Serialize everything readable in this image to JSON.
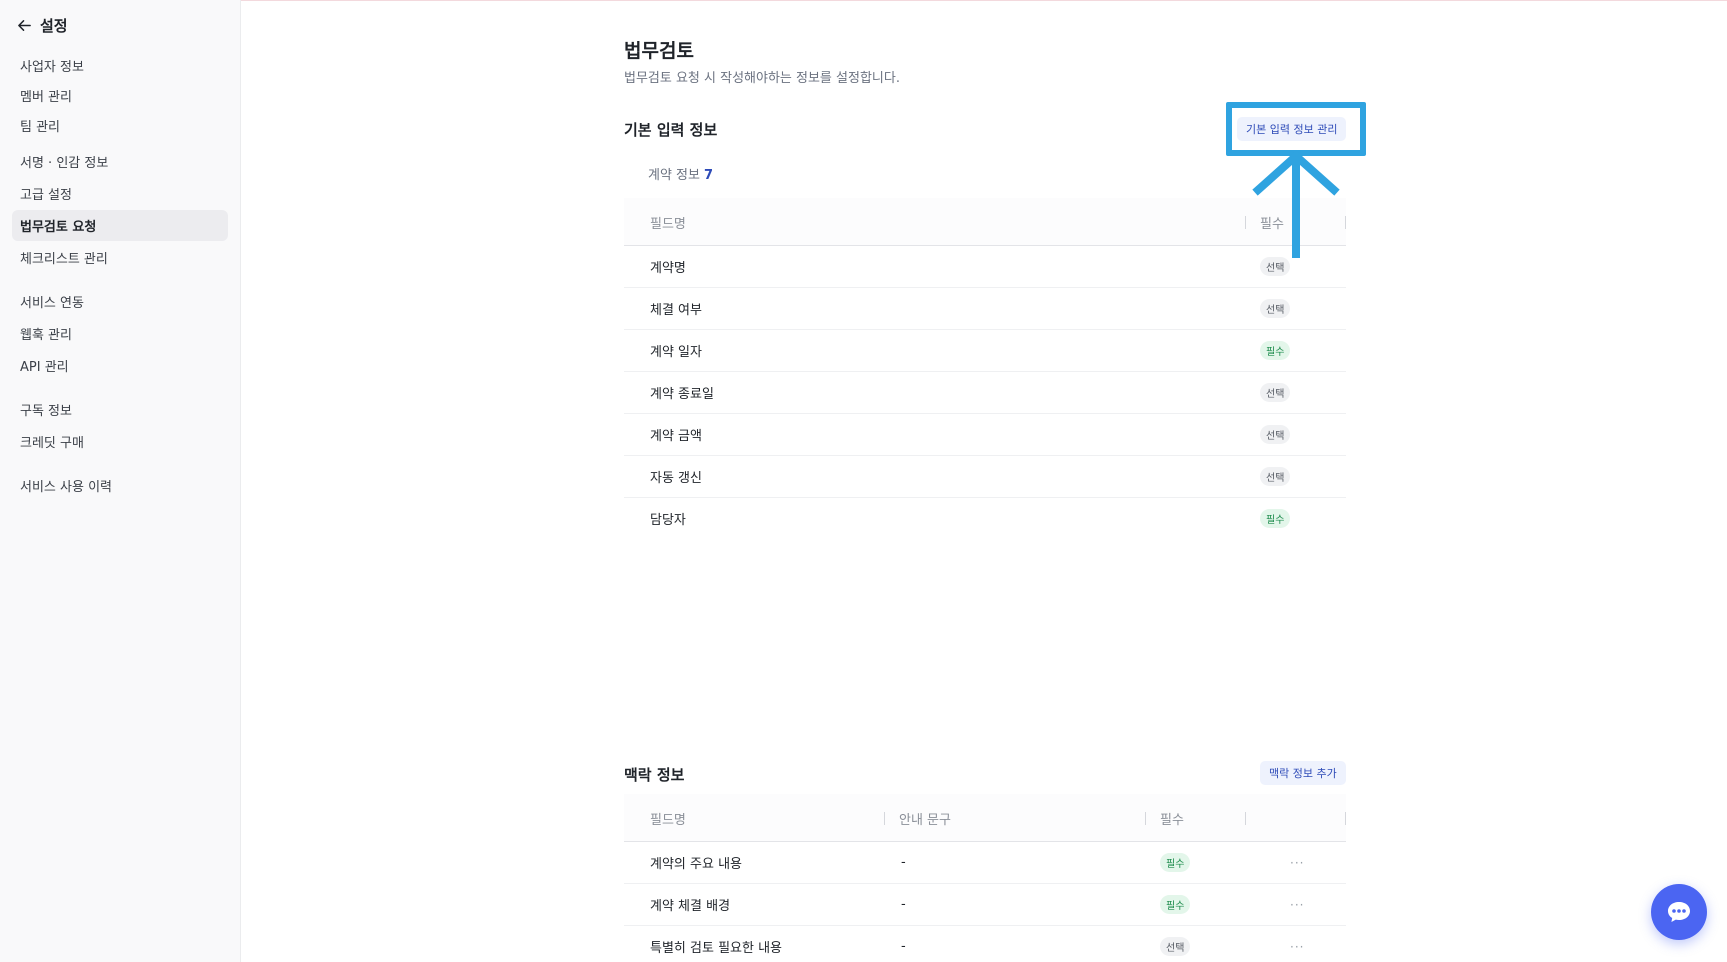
{
  "sidebar": {
    "title": "설정",
    "items": [
      {
        "label": "사업자 정보"
      },
      {
        "label": "멤버 관리"
      },
      {
        "label": "팀 관리"
      },
      {
        "label": "서명 · 인감 정보"
      },
      {
        "label": "고급 설정"
      },
      {
        "label": "법무검토 요청",
        "active": true
      },
      {
        "label": "체크리스트 관리"
      },
      {
        "label": "서비스 연동"
      },
      {
        "label": "웹훅 관리"
      },
      {
        "label": "API 관리"
      },
      {
        "label": "구독 정보"
      },
      {
        "label": "크레딧 구매"
      },
      {
        "label": "서비스 사용 이력"
      }
    ]
  },
  "page": {
    "title": "법무검토",
    "description": "법무검토 요청 시 작성해야하는 정보를 설정합니다."
  },
  "basic_info": {
    "title": "기본 입력 정보",
    "manage_button": "기본 입력 정보 관리",
    "tab_label": "계약 정보",
    "tab_count": "7",
    "columns": {
      "name": "필드명",
      "required": "필수"
    },
    "rows": [
      {
        "name": "계약명",
        "badge": "선택",
        "required": false
      },
      {
        "name": "체결 여부",
        "badge": "선택",
        "required": false
      },
      {
        "name": "계약 일자",
        "badge": "필수",
        "required": true
      },
      {
        "name": "계약 종료일",
        "badge": "선택",
        "required": false
      },
      {
        "name": "계약 금액",
        "badge": "선택",
        "required": false
      },
      {
        "name": "자동 갱신",
        "badge": "선택",
        "required": false
      },
      {
        "name": "담당자",
        "badge": "필수",
        "required": true
      }
    ]
  },
  "context_info": {
    "title": "맥락 정보",
    "add_button": "맥락 정보 추가",
    "columns": {
      "name": "필드명",
      "guide": "안내 문구",
      "required": "필수"
    },
    "rows": [
      {
        "name": "계약의 주요 내용",
        "guide": "-",
        "badge": "필수",
        "required": true,
        "more": "···"
      },
      {
        "name": "계약 체결 배경",
        "guide": "-",
        "badge": "필수",
        "required": true,
        "more": "···"
      },
      {
        "name": "특별히 검토 필요한 내용",
        "guide": "-",
        "badge": "선택",
        "required": false,
        "more": "···"
      }
    ]
  },
  "icons": {
    "back": "arrow-left-icon",
    "chat": "chat-bubble-icon"
  },
  "colors": {
    "accent": "#2e4bb8",
    "highlight": "#2fa3e0",
    "required_badge": "#1a8a4a",
    "chat_button": "#4b65f2"
  }
}
